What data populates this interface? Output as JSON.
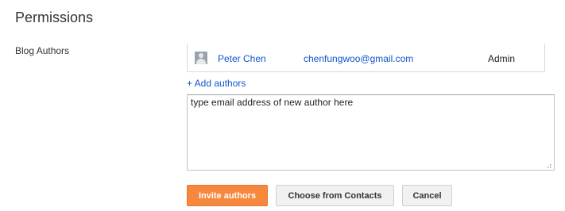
{
  "section": {
    "title": "Permissions"
  },
  "blog_authors": {
    "label": "Blog Authors",
    "authors": [
      {
        "name": "Peter Chen",
        "email": "chenfungwoo@gmail.com",
        "role": "Admin",
        "avatar_icon": "user-avatar-icon"
      }
    ],
    "add_link": "+ Add authors"
  },
  "invite": {
    "textarea_value": "type email address of new author here",
    "resize_icon": "resize-grip-icon"
  },
  "actions": {
    "invite_label": "Invite authors",
    "contacts_label": "Choose from Contacts",
    "cancel_label": "Cancel"
  },
  "colors": {
    "link": "#1155cc",
    "primary_button": "#f6883d",
    "default_button": "#f1f1f1"
  }
}
